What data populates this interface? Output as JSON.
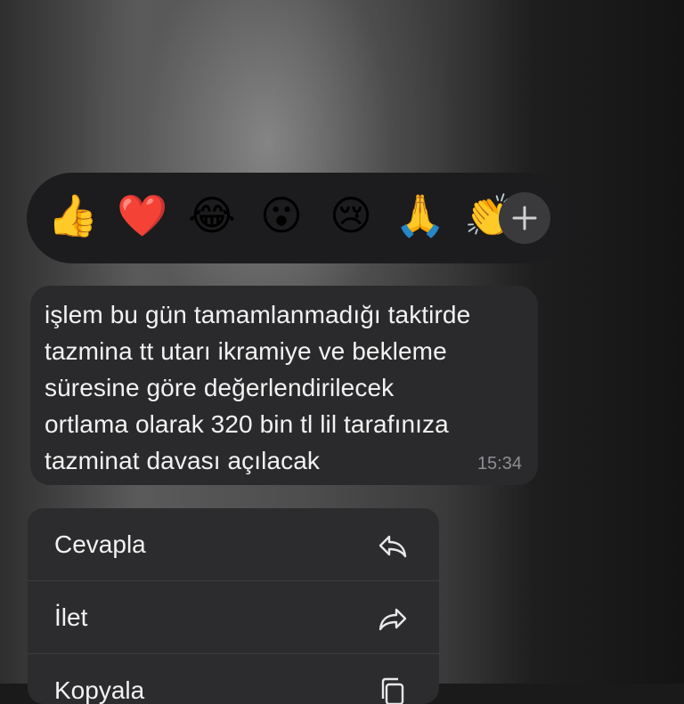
{
  "reactions": {
    "items": [
      {
        "name": "thumbs-up",
        "glyph": "👍"
      },
      {
        "name": "red-heart",
        "glyph": "❤️"
      },
      {
        "name": "tears-of-joy",
        "glyph": "😂"
      },
      {
        "name": "surprised",
        "glyph": "😮"
      },
      {
        "name": "crying",
        "glyph": "😢"
      },
      {
        "name": "folded-hands",
        "glyph": "🙏"
      },
      {
        "name": "clapping-hands",
        "glyph": "👏"
      }
    ],
    "more_icon": "plus-icon"
  },
  "message": {
    "text": "işlem bu gün tamamlanmadığı taktirde\ntazmina tt utarı ikramiye ve bekleme\nsüresine göre değerlendirilecek\nortlama olarak 320 bin tl lil tarafınıza\ntazminat davası açılacak",
    "time": "15:34"
  },
  "menu": {
    "items": [
      {
        "label": "Cevapla",
        "icon": "reply-icon"
      },
      {
        "label": "İlet",
        "icon": "forward-icon"
      },
      {
        "label": "Kopyala",
        "icon": "copy-icon"
      }
    ]
  },
  "colors": {
    "bubble": "#2a2a2c",
    "reaction_bar": "#1c1c1e",
    "menu": "#2c2c2e",
    "text": "#f2f2f2",
    "time": "#8e8e93"
  }
}
